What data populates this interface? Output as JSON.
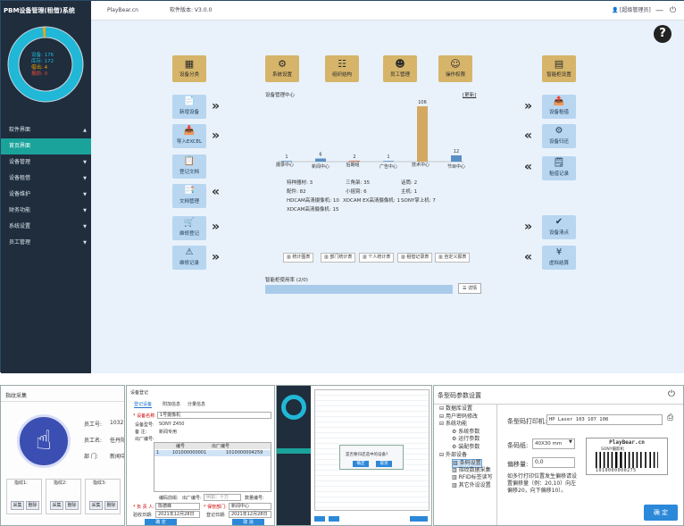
{
  "app": {
    "title": "PBM设备管理(租借)系统",
    "site": "PlayBear.cn",
    "version": "软件版本: V3.0.0",
    "user": "[超级管理员]"
  },
  "sidebar": {
    "donut": [
      {
        "label": "设备: 176",
        "value": 176,
        "color": "#f5f5f5"
      },
      {
        "label": "库存: 172",
        "value": 172,
        "color": "#21b7d6"
      },
      {
        "label": "借出: 4",
        "value": 4,
        "color": "#f4a300"
      },
      {
        "label": "报损: 0",
        "value": 0,
        "color": "#e74c3c"
      }
    ],
    "items": [
      {
        "label": "软件界面",
        "caret": "▲"
      },
      {
        "label": "首页界面",
        "caret": ""
      },
      {
        "label": "设备管理",
        "caret": "▼"
      },
      {
        "label": "设备租借",
        "caret": "▼"
      },
      {
        "label": "设备维护",
        "caret": "▼"
      },
      {
        "label": "财务功能",
        "caret": "▼"
      },
      {
        "label": "系统设置",
        "caret": "▼"
      },
      {
        "label": "员工管理",
        "caret": "▼"
      }
    ]
  },
  "tiles": {
    "device_class": "设备分类",
    "system_settings": "系统设置",
    "org": "组织结构",
    "staff": "员工管理",
    "op_perm": "操作权限",
    "smart_cabinet": "智能柜设置",
    "new_device": "新增设备",
    "import_excel": "导入EXCEL",
    "register_doc": "登记文档",
    "doc_manage": "文档管理",
    "repair_register": "维修登记",
    "repair_record": "维修记录",
    "device_rent": "设备租借",
    "device_return": "设备归还",
    "rent_record": "租借记录",
    "device_check": "设备清点",
    "virtual_settle": "虚拟结算"
  },
  "chart_data": {
    "type": "bar",
    "title": "设备管理中心",
    "legend": "[更新]",
    "categories": [
      "摄录中心",
      "新闻中心",
      "后期组",
      "广告中心",
      "技术中心",
      "节目中心"
    ],
    "values": [
      1,
      6,
      2,
      1,
      106,
      12
    ]
  },
  "stats": [
    "特种器材: 3",
    "三角架: 35",
    "话筒: 2",
    "配件: 82",
    "小摇臂: 6",
    "主机: 1",
    "HDCAM高清摄像机: 10",
    "XDCAM EX高清摄像机: 1",
    "SONY掌上机: 7",
    "XDCAM高清摄像机: 15"
  ],
  "reports": [
    "统计图表",
    "部门统计表",
    "个人统计表",
    "租借记录表",
    "自定义报表"
  ],
  "cabinet": {
    "label": "智能柜使用率",
    "value": "(2/0)",
    "detail": "详情"
  },
  "fingerprint": {
    "title": "指纹采集",
    "emp_no_label": "员工号:",
    "emp_no": "1032",
    "emp_name_label": "员工名:",
    "emp_name": "任丹阳",
    "dept_label": "部  门:",
    "dept": "新闻中心",
    "fp1": "指纹1:",
    "fp2": "指纹2:",
    "fp3": "指纹3:",
    "collect": "采集",
    "delete": "删除"
  },
  "register": {
    "title": "设备登记",
    "tabs": [
      "登记设备",
      "附加信息",
      "分量信息"
    ],
    "fields": [
      "* 设备名称:",
      "设备型号:",
      "备   注:",
      "出厂编号:"
    ],
    "name": "1号摄像机",
    "model": "SONY Z450",
    "note": "新闻专用",
    "table_head": [
      "编号",
      "出厂编号"
    ],
    "table_row": [
      "1",
      "101000000001",
      "1010000004259"
    ],
    "serial_label": "编码前缀:",
    "factory_label": "出厂编号:",
    "factory_placeholder": "例如：十万",
    "total_label": "数量编号:",
    "keeper_label": "* 负 责 人:",
    "keeper": "陈德峰",
    "dept_label": "* 保管部门:",
    "dept": "新闻中心",
    "date1_label": "验收日期:",
    "date1": "2021年12月28日",
    "date2_label": "登记日期:",
    "date2": "2021年12月28日",
    "ok": "确 定",
    "cancel": "取 消"
  },
  "mini": {
    "dialog_text": "是否要归还选中的设备?",
    "btn1": "确定",
    "btn2": "取消"
  },
  "barcode": {
    "title": "条型码参数设置",
    "tree": [
      {
        "label": "数据库设置",
        "indent": 0,
        "mark": "⊟"
      },
      {
        "label": "用户密码修改",
        "indent": 0,
        "mark": "⊟"
      },
      {
        "label": "系统功能",
        "indent": 0,
        "mark": "⊟"
      },
      {
        "label": "系统参数",
        "indent": 1,
        "mark": "⚙"
      },
      {
        "label": "运行参数",
        "indent": 1,
        "mark": "⚙"
      },
      {
        "label": "装配参数",
        "indent": 1,
        "mark": "⚙"
      },
      {
        "label": "外部设备",
        "indent": 0,
        "mark": "⊟"
      },
      {
        "label": "条码设置",
        "indent": 1,
        "mark": "▥"
      },
      {
        "label": "指纹数据采集",
        "indent": 1,
        "mark": "▥"
      },
      {
        "label": "RFID标签读写",
        "indent": 1,
        "mark": "▥"
      },
      {
        "label": "其它外设设置",
        "indent": 1,
        "mark": "▥"
      }
    ],
    "printer_label": "条型码打印机:",
    "printer": "HP Laser 103 107 108",
    "paper_label": "条码纸:",
    "paper": "40X30 mm",
    "offset_label": "偏移量:",
    "offset": "0,0",
    "hint": "如多行打印位置发生偏移请设置偏移量（例：20,10）向左偏移20，向下偏移10）。",
    "preview_site": "PlayBear.cn",
    "preview_name": "SONY摄影机",
    "preview_code": "1010000000275",
    "ok": "确 定"
  }
}
